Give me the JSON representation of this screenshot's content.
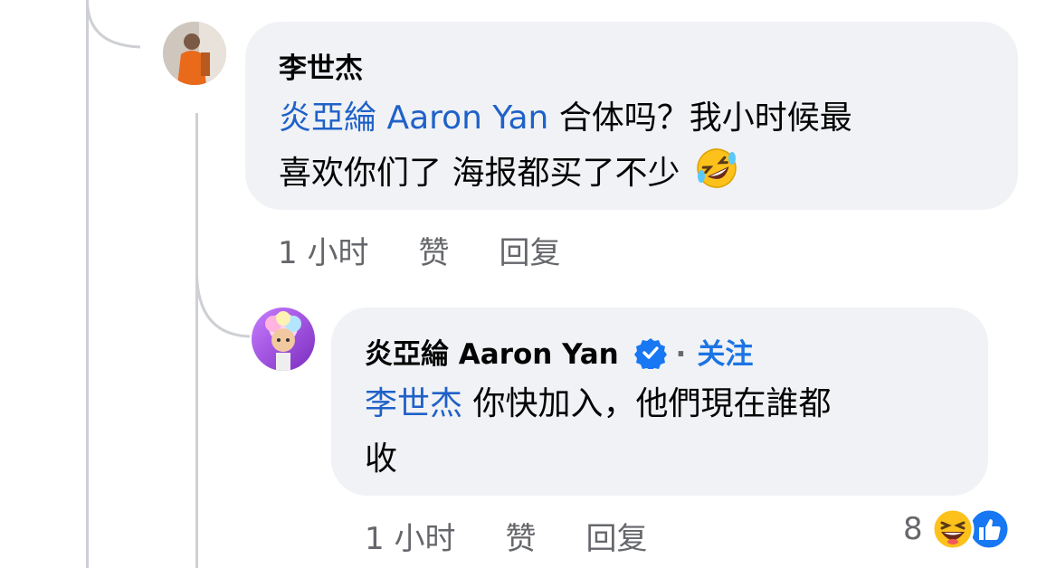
{
  "comment1": {
    "author": "李世杰",
    "mention": "炎亞綸 Aaron Yan",
    "text_line1": " 合体吗？我小时候最",
    "text_line2": "喜欢你们了 海报都买了不少",
    "emoji": "rolling-on-floor-laughing-emoji",
    "time": "1 小时",
    "like_label": "赞",
    "reply_label": "回复"
  },
  "comment2": {
    "author": "炎亞綸 Aaron Yan",
    "verified": "verified-badge-icon",
    "follow_label": "关注",
    "mention": "李世杰",
    "text_line1": " 你快加入，他們現在誰都",
    "text_line2": "收",
    "time": "1 小时",
    "like_label": "赞",
    "reply_label": "回复",
    "reaction_count": "8",
    "reactions": [
      "laughing-emoji",
      "like-icon"
    ]
  },
  "colors": {
    "mention": "#1f61c8",
    "bubble": "#f0f2f5",
    "follow": "#1b74e4",
    "meta": "#65676b"
  }
}
